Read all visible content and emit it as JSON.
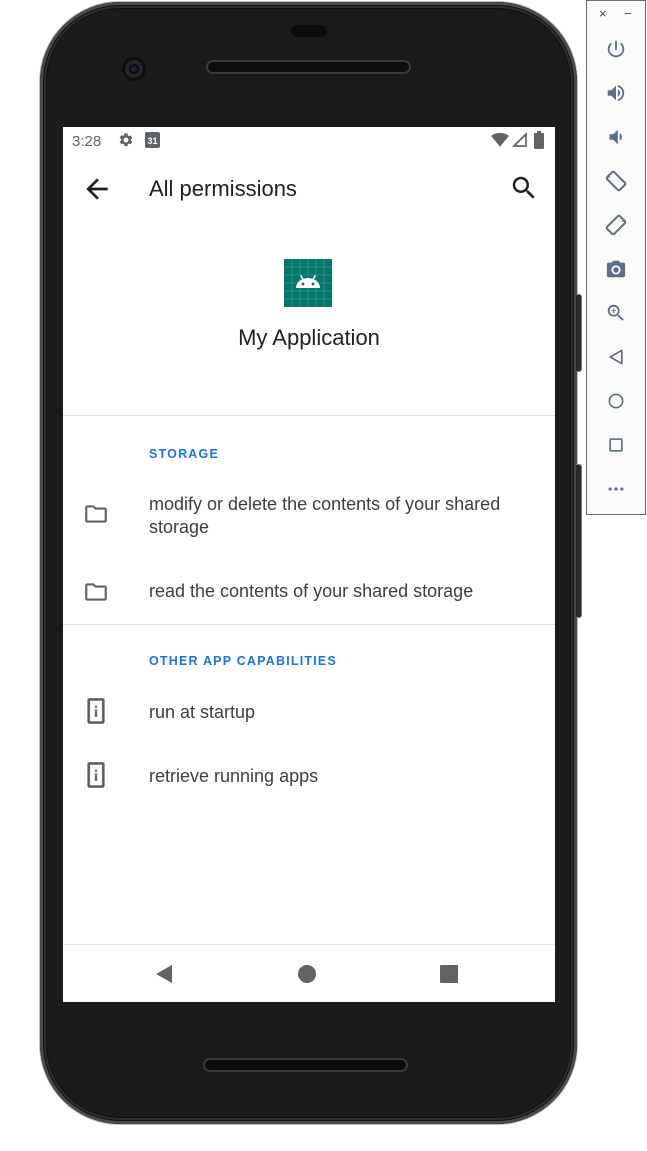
{
  "status_bar": {
    "time": "3:28",
    "icons": [
      "settings-gear-icon",
      "calendar-icon",
      "wifi-icon",
      "signal-icon",
      "battery-icon"
    ],
    "calendar_day": "31"
  },
  "app_bar": {
    "title": "All permissions",
    "icons": [
      "back-arrow-icon",
      "search-icon"
    ]
  },
  "app": {
    "name": "My Application",
    "icon": "android-app-icon",
    "icon_color": "#07766a"
  },
  "sections": [
    {
      "header": "STORAGE",
      "items": [
        {
          "icon": "folder-icon",
          "label": "modify or delete the contents of your shared storage"
        },
        {
          "icon": "folder-icon",
          "label": "read the contents of your shared storage"
        }
      ]
    },
    {
      "header": "OTHER APP CAPABILITIES",
      "items": [
        {
          "icon": "info-icon",
          "label": "run at startup"
        },
        {
          "icon": "info-icon",
          "label": "retrieve running apps"
        }
      ]
    }
  ],
  "nav_bar": {
    "icons": [
      "nav-back-icon",
      "nav-home-icon",
      "nav-recents-icon"
    ]
  },
  "emulator_toolbar": {
    "window_controls": {
      "close": "×",
      "minimize": "−"
    },
    "icons": [
      "power-icon",
      "volume-up-icon",
      "volume-down-icon",
      "rotate-left-icon",
      "rotate-right-icon",
      "screenshot-icon",
      "zoom-icon",
      "back-icon",
      "home-icon",
      "overview-icon",
      "more-icon"
    ],
    "icon_color": "#5f6f8a"
  },
  "colors": {
    "accent": "#1a73e8",
    "text_primary": "#202124",
    "text_secondary": "#5f6368"
  }
}
